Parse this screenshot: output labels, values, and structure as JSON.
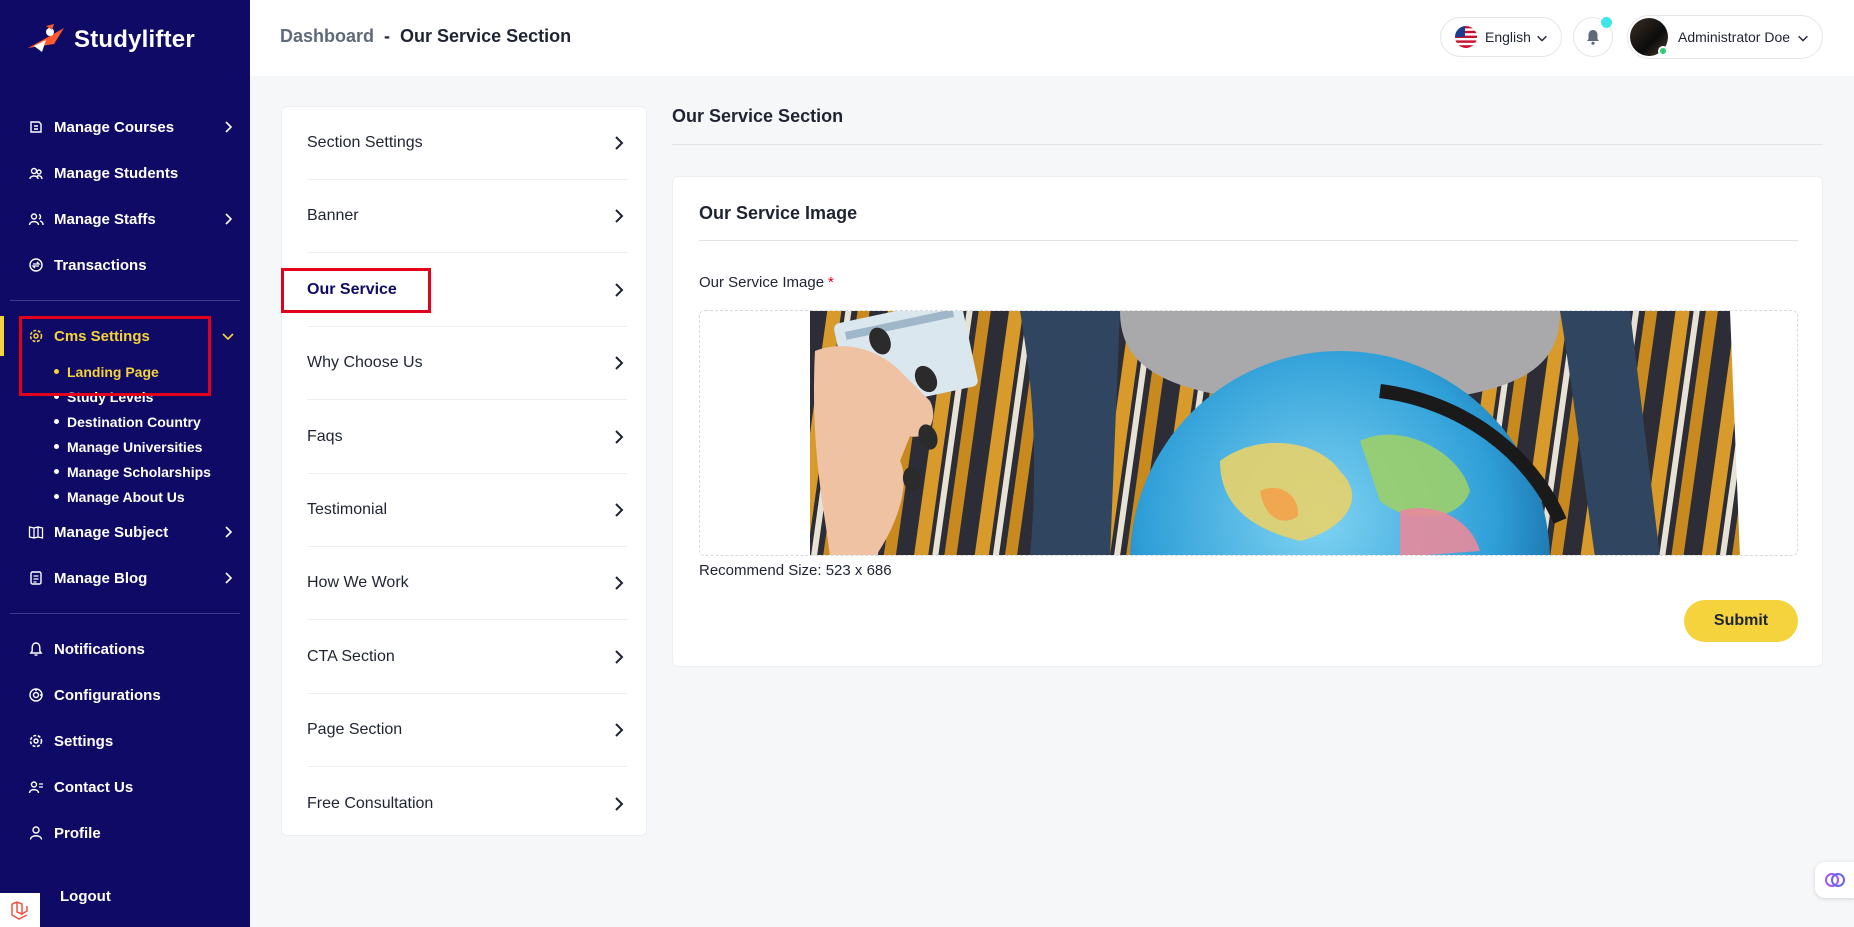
{
  "brand": {
    "name": "Studylifter"
  },
  "sidebar": {
    "items_top": [
      {
        "label": "Manage Courses",
        "icon": "courses-icon",
        "has_chevron": true
      },
      {
        "label": "Manage Students",
        "icon": "students-icon",
        "has_chevron": false
      },
      {
        "label": "Manage Staffs",
        "icon": "staffs-icon",
        "has_chevron": true
      },
      {
        "label": "Transactions",
        "icon": "transactions-icon",
        "has_chevron": false
      }
    ],
    "cms": {
      "label": "Cms Settings",
      "icon": "cms-settings-icon",
      "sub_items": [
        "Landing Page",
        "Study Levels",
        "Destination Country",
        "Manage Universities",
        "Manage Scholarships",
        "Manage About Us"
      ],
      "active_sub": "Landing Page"
    },
    "items_mid": [
      {
        "label": "Manage Subject",
        "icon": "subject-icon",
        "has_chevron": true
      },
      {
        "label": "Manage Blog",
        "icon": "blog-icon",
        "has_chevron": true
      }
    ],
    "items_bottom": [
      {
        "label": "Notifications",
        "icon": "notification-icon"
      },
      {
        "label": "Configurations",
        "icon": "configuration-icon"
      },
      {
        "label": "Settings",
        "icon": "settings-gear-icon"
      },
      {
        "label": "Contact Us",
        "icon": "contact-icon"
      },
      {
        "label": "Profile",
        "icon": "profile-icon"
      }
    ],
    "logout": "Logout"
  },
  "header": {
    "breadcrumb_root": "Dashboard",
    "breadcrumb_sep": "-",
    "breadcrumb_current": "Our Service Section",
    "language": "English",
    "user_name": "Administrator Doe"
  },
  "section_menu": [
    "Section Settings",
    "Banner",
    "Our Service",
    "Why Choose Us",
    "Faqs",
    "Testimonial",
    "How We Work",
    "CTA Section",
    "Page Section",
    "Free Consultation"
  ],
  "section_menu_active": "Our Service",
  "content": {
    "section_title": "Our Service Section",
    "card_title": "Our Service Image",
    "field_label": "Our Service Image",
    "required_mark": "*",
    "recommend": "Recommend Size: 523 x 686",
    "submit": "Submit"
  },
  "colors": {
    "sidebar_bg": "#0e0a66",
    "accent_yellow": "#f5d33c",
    "highlight_red": "#e3001b"
  }
}
